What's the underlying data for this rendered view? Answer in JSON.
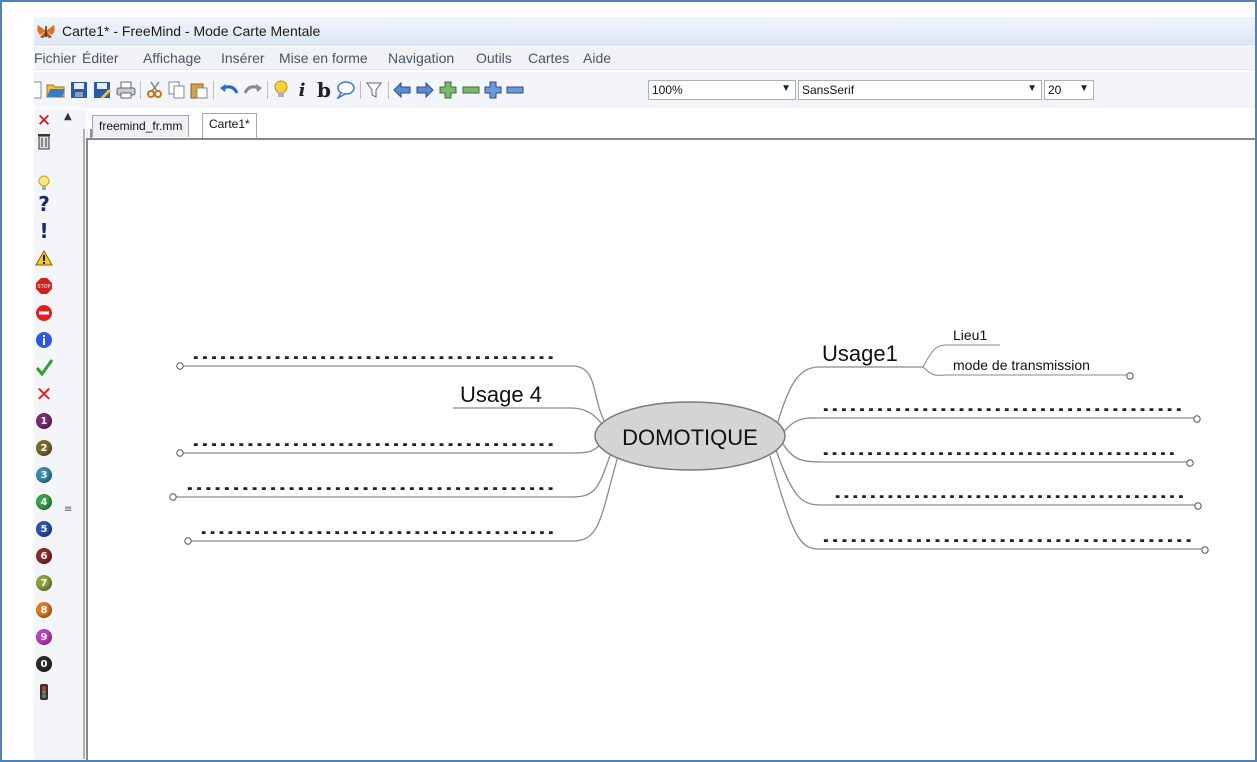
{
  "window": {
    "title": "Carte1* - FreeMind - Mode Carte Mentale"
  },
  "menu": [
    "Fichier",
    "Éditer",
    "Affichage",
    "Insérer",
    "Mise en forme",
    "Navigation",
    "Outils",
    "Cartes",
    "Aide"
  ],
  "toolbar": {
    "zoom_value": "100%",
    "font_value": "SansSerif",
    "size_value": "20",
    "italic_label": "i",
    "bold_label": "b"
  },
  "tabs": [
    {
      "label": "freemind_fr.mm",
      "active": false
    },
    {
      "label": "Carte1*",
      "active": true
    }
  ],
  "icon_panel": {
    "numbers": [
      "1",
      "2",
      "3",
      "4",
      "5",
      "6",
      "7",
      "8",
      "9",
      "0"
    ],
    "number_colors": [
      "#7a2a6e",
      "#7a6a2a",
      "#3a8ab0",
      "#3aa048",
      "#2a52b0",
      "#8a2a2a",
      "#8aa040",
      "#e07a20",
      "#c040c0",
      "#2a2a2a"
    ],
    "question": "?",
    "exclamation": "!"
  },
  "mindmap": {
    "center": "DOMOTIQUE",
    "usage1": "Usage1",
    "lieu1": "Lieu1",
    "transmission": "mode de transmission",
    "usage4": "Usage 4",
    "placeholder": "........................................"
  }
}
